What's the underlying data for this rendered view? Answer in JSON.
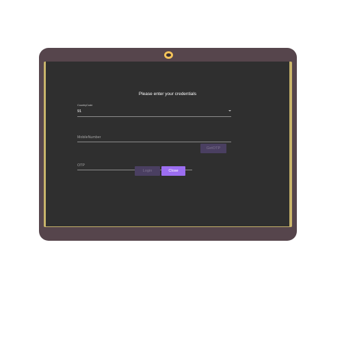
{
  "dialog": {
    "title": "Please enter your credentials"
  },
  "country_code": {
    "label": "CountryCode",
    "value": "91"
  },
  "mobile": {
    "placeholder": "MobileNumber"
  },
  "otp": {
    "placeholder": "OTP",
    "get_otp_label": "GetOTP"
  },
  "actions": {
    "login_label": "Login",
    "close_label": "Close"
  },
  "colors": {
    "frame": "#56454c",
    "screen": "#2f2f2f",
    "accent": "#9c6ef1",
    "disabled_button": "#4a3f61",
    "camera": "#f3c35a"
  },
  "state": {
    "login_disabled": true,
    "get_otp_disabled": true
  }
}
